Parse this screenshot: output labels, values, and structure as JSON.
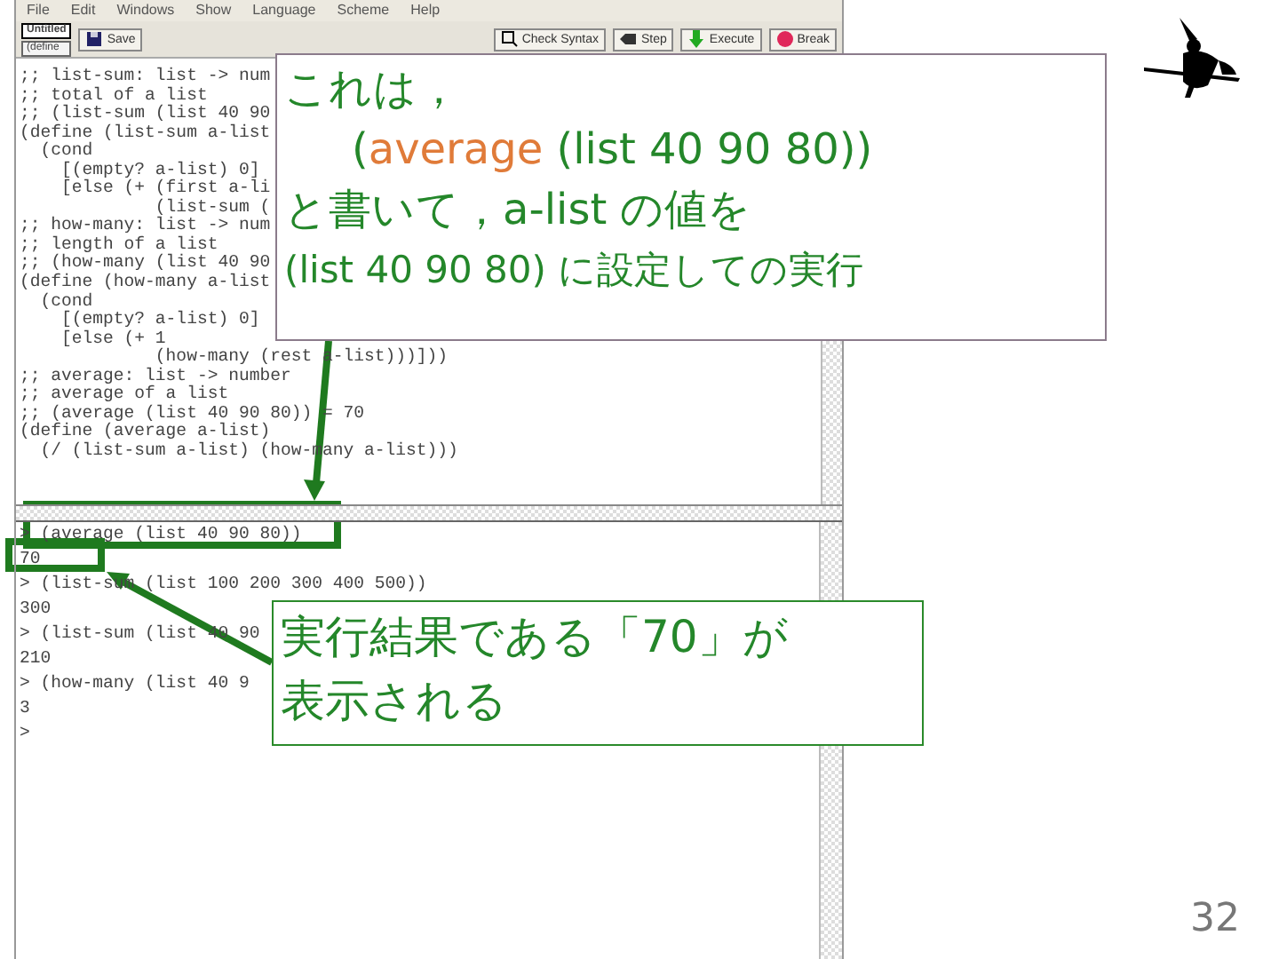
{
  "window": {
    "menu": [
      "File",
      "Edit",
      "Windows",
      "Show",
      "Language",
      "Scheme",
      "Help"
    ],
    "tabs": [
      {
        "label": "Untitled",
        "selected": true
      },
      {
        "label": "(define",
        "selected": false
      }
    ],
    "toolbar_buttons": [
      {
        "label": "Save",
        "kind": "save"
      },
      {
        "label": "Check Syntax",
        "kind": "check"
      },
      {
        "label": "Step",
        "kind": "step"
      },
      {
        "label": "Execute",
        "kind": "execute"
      },
      {
        "label": "Break",
        "kind": "break"
      }
    ]
  },
  "definitions": [
    ";; list-sum: list -> num",
    ";; total of a list",
    ";; (list-sum (list 40 90",
    "(define (list-sum a-list",
    "  (cond",
    "    [(empty? a-list) 0]",
    "    [else (+ (first a-li",
    "             (list-sum (",
    ";; how-many: list -> num",
    ";; length of a list",
    ";; (how-many (list 40 90",
    "(define (how-many a-list",
    "  (cond",
    "    [(empty? a-list) 0]",
    "    [else (+ 1",
    "             (how-many (rest a-list)))]))",
    ";; average: list -> number",
    ";; average of a list",
    ";; (average (list 40 90 80)) = 70",
    "(define (average a-list)",
    "  (/ (list-sum a-list) (how-many a-list)))"
  ],
  "interactions": [
    "> (average (list 40 90 80))",
    "70",
    "> (list-sum (list 100 200 300 400 500))",
    "300",
    "> (list-sum (list 40 90",
    "210",
    "> (how-many (list 40 9",
    "3",
    ">"
  ],
  "callouts": [
    {
      "kind": "note",
      "lines": [
        [
          {
            "text": "これは，",
            "kind": "plain"
          }
        ],
        [
          {
            "text": "(",
            "kind": "plain"
          },
          {
            "text": "average",
            "kind": "keyword"
          },
          {
            "text": " (list 40 90 80))",
            "kind": "plain"
          }
        ],
        [
          {
            "text": "と書いて，a-list の値を",
            "kind": "plain"
          }
        ],
        [
          {
            "text": "(list 40 90 80) に設定しての実行",
            "kind": "plain"
          }
        ]
      ]
    },
    {
      "kind": "result",
      "lines": [
        [
          {
            "text": "実行結果である「70」が",
            "kind": "plain"
          }
        ],
        [
          {
            "text": "表示される",
            "kind": "plain"
          }
        ]
      ]
    }
  ],
  "page_number": "32"
}
